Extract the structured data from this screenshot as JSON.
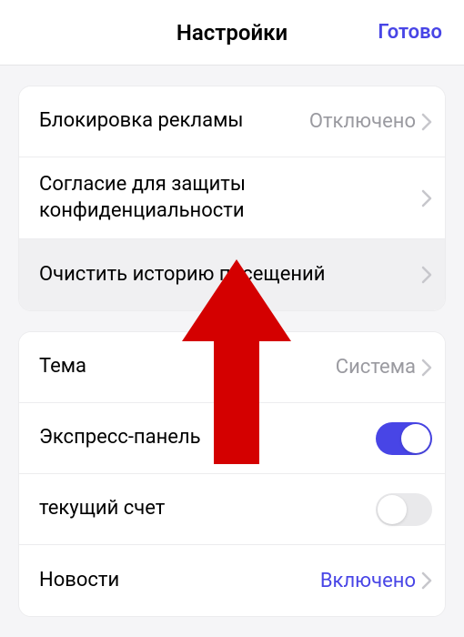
{
  "header": {
    "title": "Настройки",
    "done": "Готово"
  },
  "group1": {
    "adblock": {
      "label": "Блокировка рекламы",
      "value": "Отключено"
    },
    "privacy": {
      "label": "Согласие для защиты конфиденциальности"
    },
    "clearHistory": {
      "label": "Очистить историю посещений"
    }
  },
  "group2": {
    "theme": {
      "label": "Тема",
      "value": "Система"
    },
    "speedDial": {
      "label": "Экспресс-панель",
      "on": true
    },
    "liveScore": {
      "label": "текущий счет",
      "on": false
    },
    "news": {
      "label": "Новости",
      "value": "Включено"
    }
  },
  "colors": {
    "accent": "#4845e6",
    "arrow": "#d40000"
  }
}
